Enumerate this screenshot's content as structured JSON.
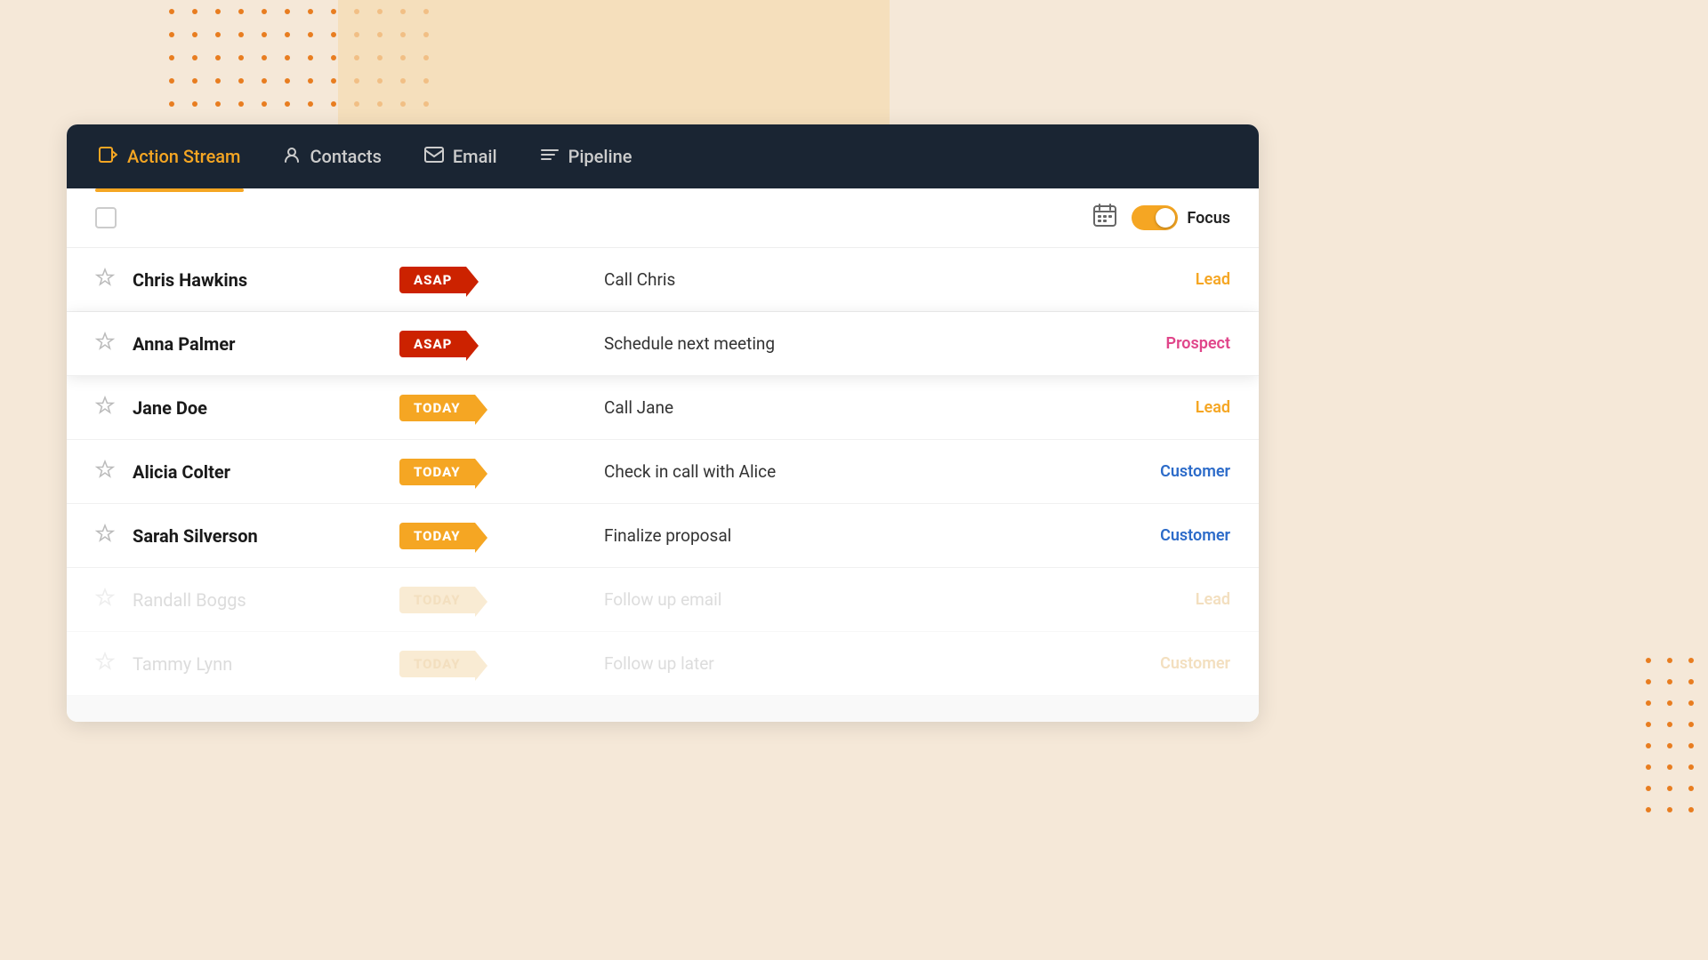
{
  "background": {
    "dotColor": "#e87d20",
    "creamColor": "#f5dbb0"
  },
  "navbar": {
    "items": [
      {
        "id": "action-stream",
        "label": "Action Stream",
        "icon": "▶",
        "active": true
      },
      {
        "id": "contacts",
        "label": "Contacts",
        "icon": "👤",
        "active": false
      },
      {
        "id": "email",
        "label": "Email",
        "icon": "✉",
        "active": false
      },
      {
        "id": "pipeline",
        "label": "Pipeline",
        "icon": "☰",
        "active": false
      }
    ]
  },
  "toolbar": {
    "focus_label": "Focus",
    "toggle_on": true
  },
  "rows": [
    {
      "id": 1,
      "name": "Chris Hawkins",
      "badge": "ASAP",
      "badge_type": "asap",
      "action": "Call Chris",
      "contact_type": "Lead",
      "type_class": "type-lead",
      "highlighted": false,
      "faded": false
    },
    {
      "id": 2,
      "name": "Anna Palmer",
      "badge": "ASAP",
      "badge_type": "asap",
      "action": "Schedule next meeting",
      "contact_type": "Prospect",
      "type_class": "type-prospect",
      "highlighted": true,
      "faded": false
    },
    {
      "id": 3,
      "name": "Jane Doe",
      "badge": "TODAY",
      "badge_type": "today",
      "action": "Call Jane",
      "contact_type": "Lead",
      "type_class": "type-lead",
      "highlighted": false,
      "faded": false
    },
    {
      "id": 4,
      "name": "Alicia Colter",
      "badge": "TODAY",
      "badge_type": "today",
      "action": "Check in call with Alice",
      "contact_type": "Customer",
      "type_class": "type-customer",
      "highlighted": false,
      "faded": false
    },
    {
      "id": 5,
      "name": "Sarah Silverson",
      "badge": "TODAY",
      "badge_type": "today",
      "action": "Finalize proposal",
      "contact_type": "Customer",
      "type_class": "type-customer",
      "highlighted": false,
      "faded": false
    },
    {
      "id": 6,
      "name": "Randall Boggs",
      "badge": "TODAY",
      "badge_type": "today-faded",
      "action": "Follow up email",
      "contact_type": "Lead",
      "type_class": "type-lead-faded",
      "highlighted": false,
      "faded": true
    },
    {
      "id": 7,
      "name": "Tammy Lynn",
      "badge": "TODAY",
      "badge_type": "today-faded",
      "action": "Follow up later",
      "contact_type": "Customer",
      "type_class": "type-lead-faded",
      "highlighted": false,
      "faded": true
    }
  ]
}
